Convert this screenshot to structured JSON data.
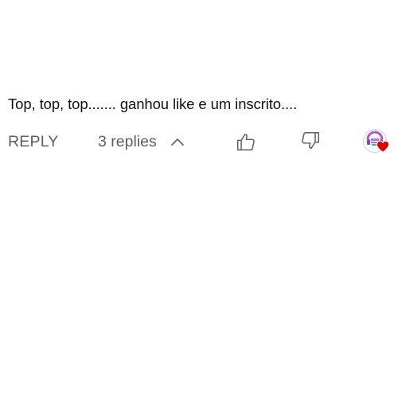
{
  "comment": {
    "text": "Top, top, top....... ganhou like e um inscrito...."
  },
  "actions": {
    "reply_label": "REPLY",
    "replies_label": "3 replies",
    "replies_expanded": true,
    "like_icon": "thumbs-up-icon",
    "dislike_icon": "thumbs-down-icon",
    "creator_heart_icon": "heart-icon"
  },
  "colors": {
    "text_primary": "#111111",
    "text_secondary": "#606060",
    "heart": "#e00000"
  }
}
